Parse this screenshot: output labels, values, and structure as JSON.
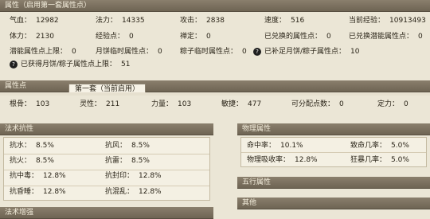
{
  "attributes": {
    "header": "属性（启用第一套属性点）",
    "rows": [
      [
        {
          "label": "气血：",
          "value": "12982"
        },
        {
          "label": "法力：",
          "value": "14335"
        },
        {
          "label": "攻击：",
          "value": "2838"
        },
        {
          "label": "速度：",
          "value": "516"
        },
        {
          "label": "当前经验：",
          "value": "10913493"
        }
      ],
      [
        {
          "label": "体力：",
          "value": "2130"
        },
        {
          "label": "经验点：",
          "value": "0"
        },
        {
          "label": "禅定：",
          "value": "0"
        },
        {
          "label": "已兑换的属性点：",
          "value": "0"
        },
        {
          "label": "已兑换潜能属性点：",
          "value": "0"
        }
      ],
      [
        {
          "label": "潜能属性点上限：",
          "value": "0"
        },
        {
          "label": "月饼临时属性点：",
          "value": "0"
        },
        {
          "label": "粽子临时属性点：",
          "value": "0"
        },
        {
          "label": "已补足月饼/粽子属性点：",
          "value": "10"
        }
      ]
    ],
    "limit_text": "已获得月饼/粽子属性点上限：",
    "limit_value": "51"
  },
  "points": {
    "header": "属性点",
    "tab_label": "第一套（当前启用）",
    "stats": [
      {
        "label": "根骨：",
        "value": "103"
      },
      {
        "label": "灵性：",
        "value": "211"
      },
      {
        "label": "力量：",
        "value": "103"
      },
      {
        "label": "敏捷：",
        "value": "477"
      },
      {
        "label": "可分配点数：",
        "value": "0"
      },
      {
        "label": "定力：",
        "value": "0"
      }
    ]
  },
  "magic_resist": {
    "header": "法术抗性",
    "rows": [
      [
        {
          "label": "抗水：",
          "value": "8.5%"
        },
        {
          "label": "抗风：",
          "value": "8.5%"
        }
      ],
      [
        {
          "label": "抗火：",
          "value": "8.5%"
        },
        {
          "label": "抗雷：",
          "value": "8.5%"
        }
      ],
      [
        {
          "label": "抗中毒：",
          "value": "12.8%"
        },
        {
          "label": "抗封印：",
          "value": "12.8%"
        }
      ],
      [
        {
          "label": "抗昏睡：",
          "value": "12.8%"
        },
        {
          "label": "抗混乱：",
          "value": "12.8%"
        }
      ]
    ]
  },
  "physical": {
    "header": "物理属性",
    "rows": [
      [
        {
          "label": "命中率：",
          "value": "10.1%"
        },
        {
          "label": "致命几率：",
          "value": "5.0%"
        }
      ],
      [
        {
          "label": "物理吸收率：",
          "value": "12.8%"
        },
        {
          "label": "狂暴几率：",
          "value": "5.0%"
        }
      ]
    ]
  },
  "five_elements": {
    "header": "五行属性"
  },
  "other": {
    "header": "其他"
  },
  "magic_boost": {
    "header": "法术增强"
  }
}
